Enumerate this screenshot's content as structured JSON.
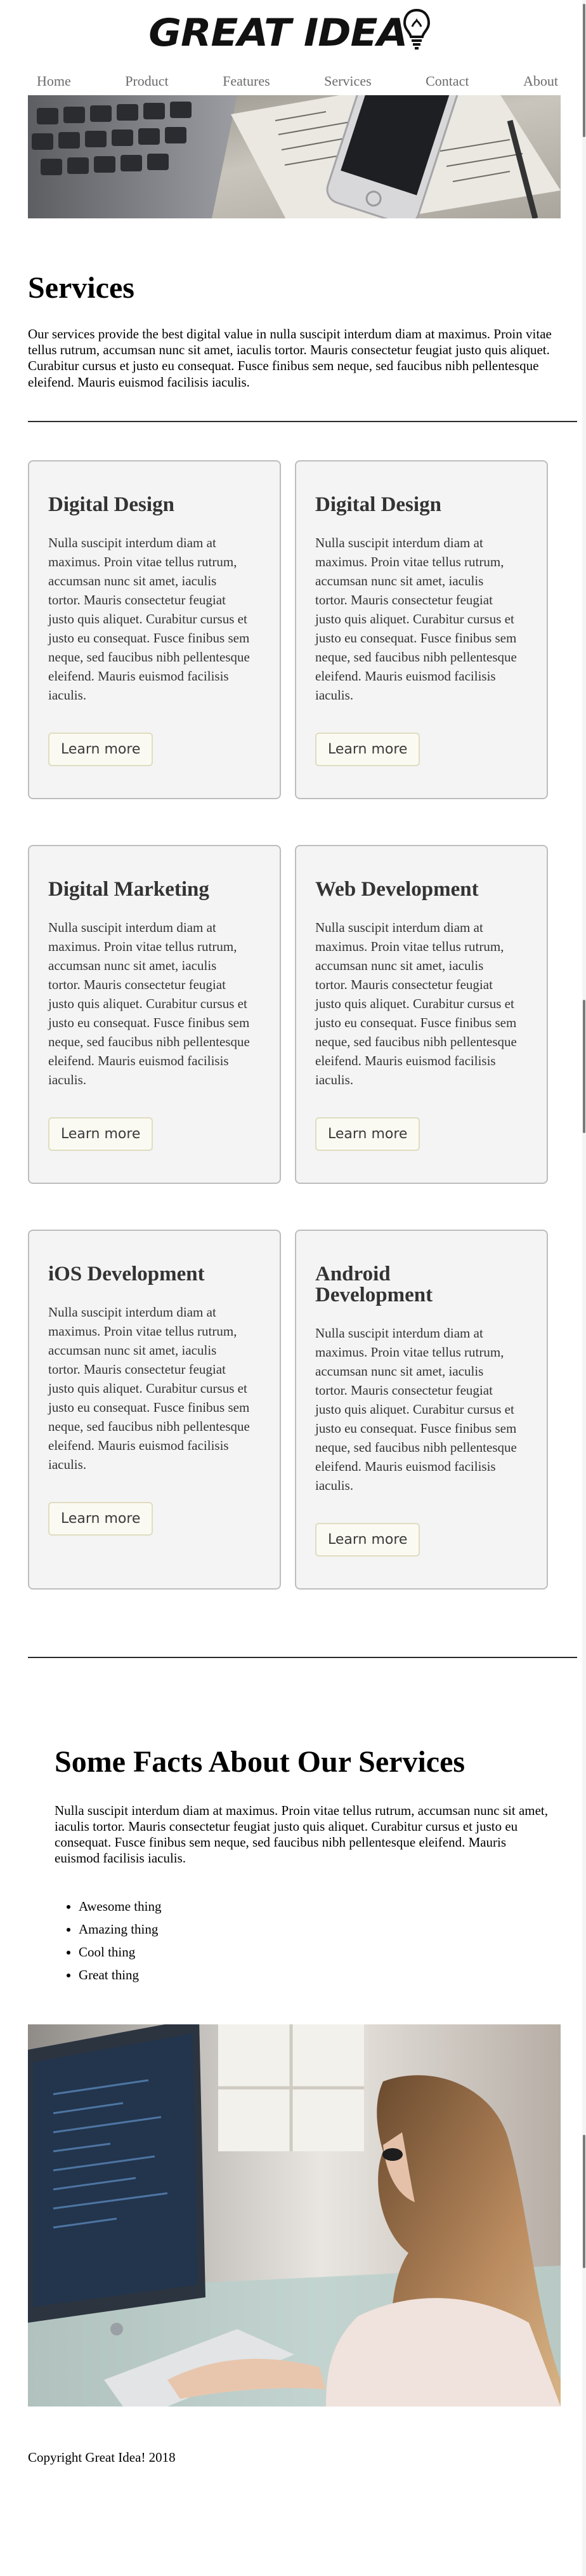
{
  "brand": {
    "logo_text": "GREAT IDEA"
  },
  "nav": {
    "items": [
      {
        "label": "Home"
      },
      {
        "label": "Product"
      },
      {
        "label": "Features"
      },
      {
        "label": "Services"
      },
      {
        "label": "Contact"
      },
      {
        "label": "About"
      }
    ]
  },
  "services": {
    "title": "Services",
    "intro": "Our services provide the best digital value in nulla suscipit interdum diam at maximus. Proin vitae tellus rutrum, accumsan nunc sit amet, iaculis tortor. Mauris consectetur feugiat justo quis aliquet. Curabitur cursus et justo eu consequat. Fusce finibus sem neque, sed faucibus nibh pellentesque eleifend. Mauris euismod facilisis iaculis."
  },
  "cards": [
    {
      "title": "Digital Design",
      "text": "Nulla suscipit interdum diam at maximus. Proin vitae tellus rutrum, accumsan nunc sit amet, iaculis tortor. Mauris consectetur feugiat justo quis aliquet. Curabitur cursus et justo eu consequat. Fusce finibus sem neque, sed faucibus nibh pellentesque eleifend. Mauris euismod facilisis iaculis.",
      "button": "Learn more"
    },
    {
      "title": "Digital Design",
      "text": "Nulla suscipit interdum diam at maximus. Proin vitae tellus rutrum, accumsan nunc sit amet, iaculis tortor. Mauris consectetur feugiat justo quis aliquet. Curabitur cursus et justo eu consequat. Fusce finibus sem neque, sed faucibus nibh pellentesque eleifend. Mauris euismod facilisis iaculis.",
      "button": "Learn more"
    },
    {
      "title": "Digital Marketing",
      "text": "Nulla suscipit interdum diam at maximus. Proin vitae tellus rutrum, accumsan nunc sit amet, iaculis tortor. Mauris consectetur feugiat justo quis aliquet. Curabitur cursus et justo eu consequat. Fusce finibus sem neque, sed faucibus nibh pellentesque eleifend. Mauris euismod facilisis iaculis.",
      "button": "Learn more"
    },
    {
      "title": "Web Development",
      "text": "Nulla suscipit interdum diam at maximus. Proin vitae tellus rutrum, accumsan nunc sit amet, iaculis tortor. Mauris consectetur feugiat justo quis aliquet. Curabitur cursus et justo eu consequat. Fusce finibus sem neque, sed faucibus nibh pellentesque eleifend. Mauris euismod facilisis iaculis.",
      "button": "Learn more"
    },
    {
      "title": "iOS Development",
      "text": "Nulla suscipit interdum diam at maximus. Proin vitae tellus rutrum, accumsan nunc sit amet, iaculis tortor. Mauris consectetur feugiat justo quis aliquet. Curabitur cursus et justo eu consequat. Fusce finibus sem neque, sed faucibus nibh pellentesque eleifend. Mauris euismod facilisis iaculis.",
      "button": "Learn more"
    },
    {
      "title": "Android Development",
      "text": "Nulla suscipit interdum diam at maximus. Proin vitae tellus rutrum, accumsan nunc sit amet, iaculis tortor. Mauris consectetur feugiat justo quis aliquet. Curabitur cursus et justo eu consequat. Fusce finibus sem neque, sed faucibus nibh pellentesque eleifend. Mauris euismod facilisis iaculis.",
      "button": "Learn more"
    }
  ],
  "facts": {
    "title": "Some Facts About Our Services",
    "text": "Nulla suscipit interdum diam at maximus. Proin vitae tellus rutrum, accumsan nunc sit amet, iaculis tortor. Mauris consectetur feugiat justo quis aliquet. Curabitur cursus et justo eu consequat. Fusce finibus sem neque, sed faucibus nibh pellentesque eleifend. Mauris euismod facilisis iaculis.",
    "list": [
      "Awesome thing",
      "Amazing thing",
      "Cool thing",
      "Great thing"
    ]
  },
  "footer": {
    "text": "Copyright Great Idea! 2018"
  },
  "colors": {
    "nav_text": "#6b6b6b",
    "card_bg": "#f4f4f4",
    "card_border": "#bdbdbd",
    "button_bg": "#fbfaf2",
    "button_border": "#e0dcc0"
  },
  "icons": {
    "logo_icon": "lightbulb-icon"
  }
}
